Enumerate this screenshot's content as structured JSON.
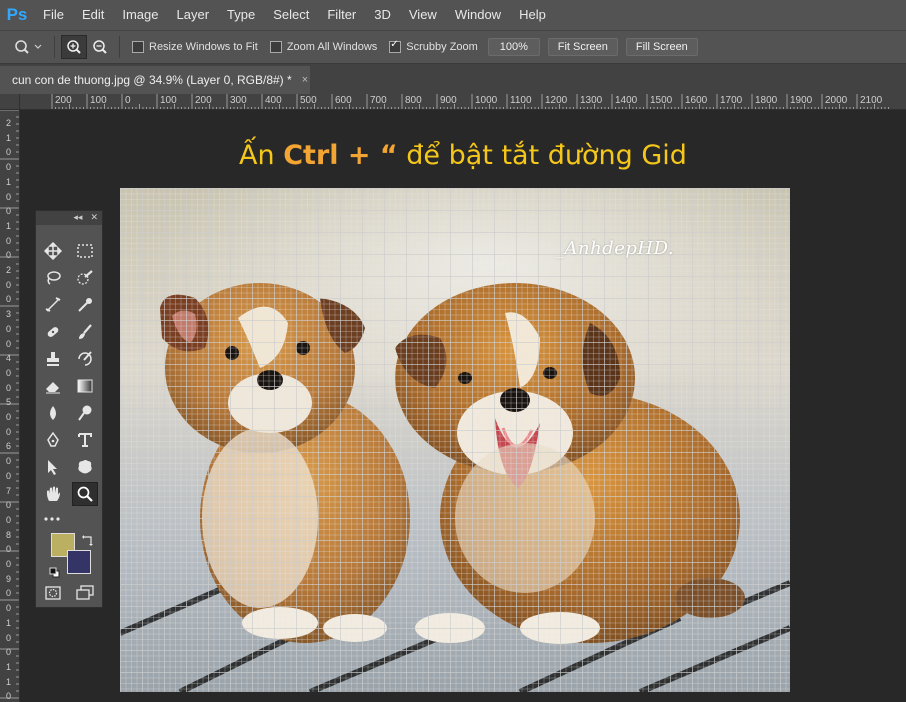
{
  "app": {
    "logo": "Ps"
  },
  "menu": [
    "File",
    "Edit",
    "Image",
    "Layer",
    "Type",
    "Select",
    "Filter",
    "3D",
    "View",
    "Window",
    "Help"
  ],
  "options": {
    "tool_icon": "zoom-icon",
    "resize_windows_label": "Resize Windows to Fit",
    "resize_windows_checked": false,
    "zoom_all_label": "Zoom All Windows",
    "zoom_all_checked": false,
    "scrubby_label": "Scrubby Zoom",
    "scrubby_checked": true,
    "btn_100": "100%",
    "btn_fit": "Fit Screen",
    "btn_fill": "Fill Screen"
  },
  "tab": {
    "title": "cun con de thuong.jpg @ 34.9% (Layer 0, RGB/8#) *",
    "close": "×"
  },
  "ruler_top": [
    "200",
    "100",
    "0",
    "100",
    "200",
    "300",
    "400",
    "500",
    "600",
    "700",
    "800",
    "900",
    "1000",
    "1100",
    "1200",
    "1300",
    "1400",
    "1500",
    "1600",
    "1700",
    "1800",
    "1900",
    "2000",
    "2100"
  ],
  "ruler_left": [
    "2",
    "1",
    "0",
    "0",
    "1",
    "0",
    "0",
    "1",
    "0",
    "0",
    "2",
    "0",
    "0",
    "3",
    "0",
    "0",
    "4",
    "0",
    "0",
    "5",
    "0",
    "0",
    "6",
    "0",
    "0",
    "7",
    "0",
    "0",
    "8",
    "0",
    "0",
    "9",
    "0",
    "0",
    "1",
    "0",
    "0",
    "1",
    "1",
    "0"
  ],
  "caption": {
    "part1": "Ấn ",
    "part2": "Ctrl + “",
    "part3": " để bật tắt đường Gid"
  },
  "watermark": "_AnhdepHD.",
  "colors": {
    "foreground": "#bbb061",
    "background": "#343466",
    "accent": "#31a8ff"
  }
}
